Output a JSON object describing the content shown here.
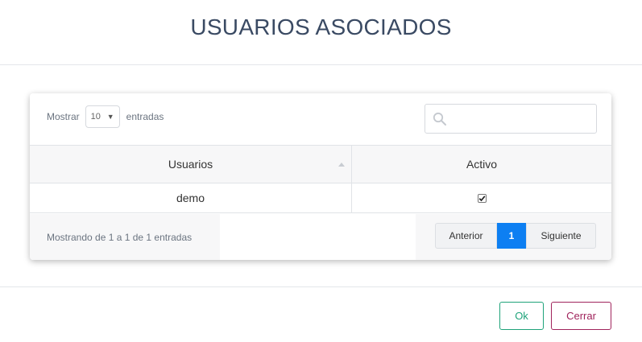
{
  "modal": {
    "title": "USUARIOS ASOCIADOS"
  },
  "table_controls": {
    "length_prefix": "Mostrar",
    "length_value": "10",
    "length_suffix": "entradas",
    "search_value": ""
  },
  "table": {
    "columns": [
      "Usuarios",
      "Activo"
    ],
    "rows": [
      {
        "usuario": "demo",
        "activo": true
      }
    ]
  },
  "footer_info": "Mostrando de 1 a 1 de 1 entradas",
  "pagination": {
    "prev_label": "Anterior",
    "current_page": "1",
    "next_label": "Siguiente"
  },
  "actions": {
    "ok_label": "Ok",
    "close_label": "Cerrar"
  },
  "colors": {
    "title": "#3a4a63",
    "active_page": "#0d7ff2",
    "ok": "#1fa37a",
    "close": "#a0245c"
  }
}
